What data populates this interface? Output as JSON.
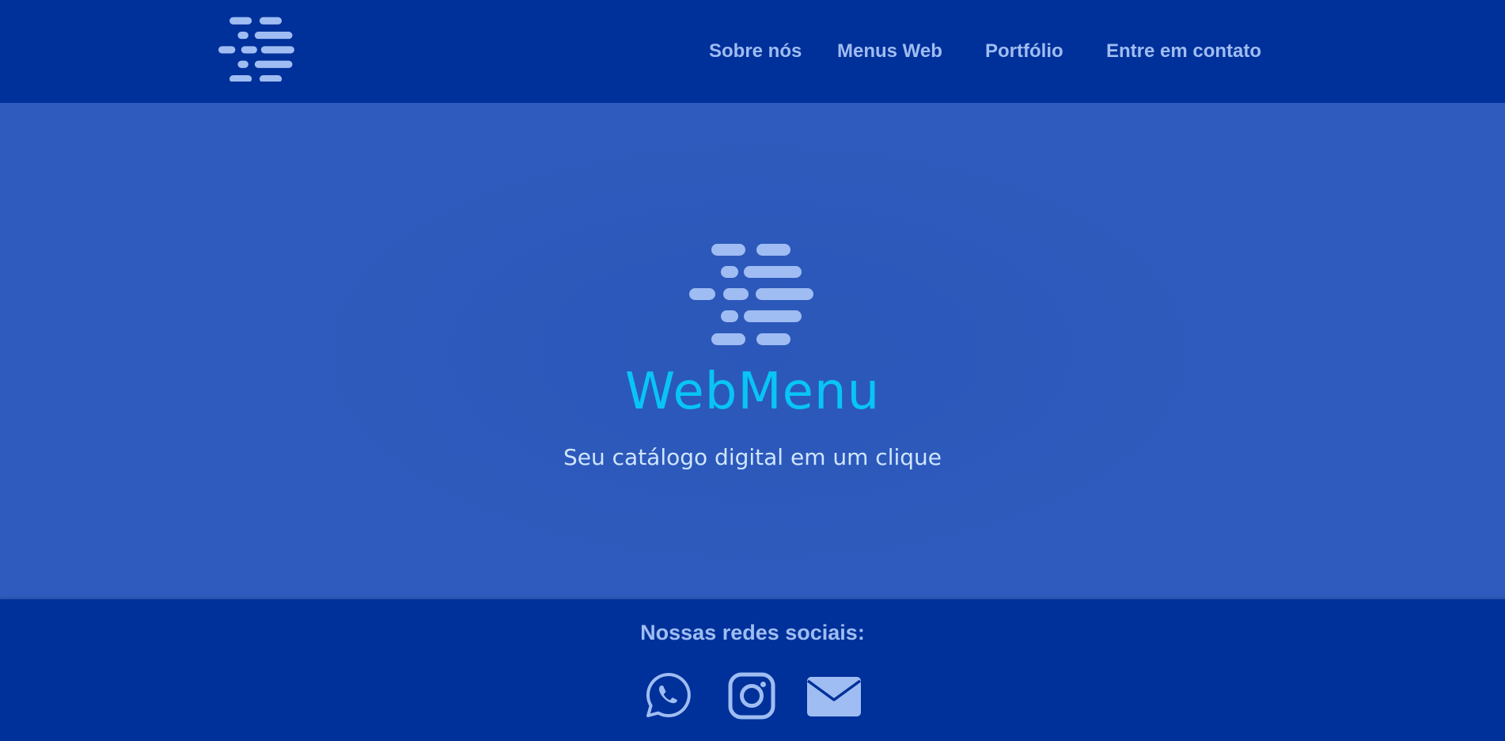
{
  "colors": {
    "header_bg": "#00309a",
    "hero_bg": "#2e5bbd",
    "nav_text": "#9fbdf2",
    "brand": "#08c4f7",
    "tagline": "#cfe6ff",
    "icon": "#9fbdf2"
  },
  "header": {
    "logo_icon": "webmenu-logo-icon",
    "nav": [
      {
        "label": "Sobre nós"
      },
      {
        "label": "Menus Web"
      },
      {
        "label": "Portfólio"
      },
      {
        "label": "Entre em contato"
      }
    ]
  },
  "hero": {
    "logo_icon": "webmenu-logo-icon",
    "brand": "WebMenu",
    "tagline": "Seu catálogo digital em um clique"
  },
  "footer": {
    "title": "Nossas redes sociais:",
    "social": [
      {
        "icon": "whatsapp-icon"
      },
      {
        "icon": "instagram-icon"
      },
      {
        "icon": "email-icon"
      }
    ]
  }
}
